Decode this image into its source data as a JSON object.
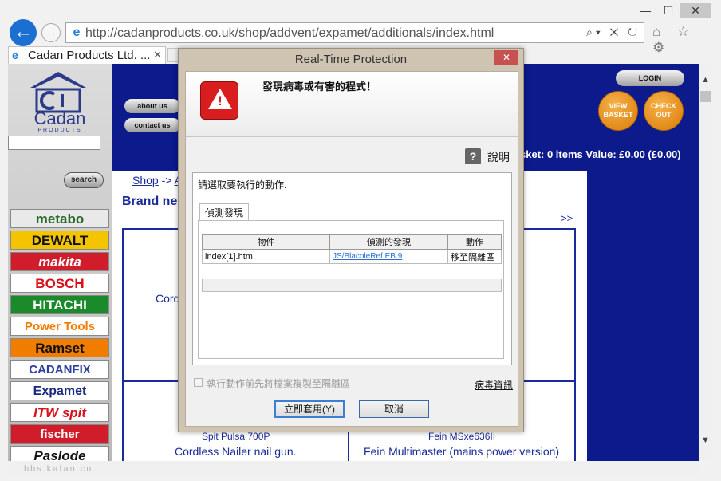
{
  "browser": {
    "url": "http://cadanproducts.co.uk/shop/addvent/expamet/additionals/index.html",
    "tab_title": "Cadan Products Ltd. ...",
    "window_minimize": "—",
    "window_maximize": "☐",
    "window_close": "✕",
    "back_glyph": "←",
    "forward_glyph": "→",
    "address_tools": "⌕▾ ✕ ↻",
    "toolbar_icons": "⌂ ☆ ⚙",
    "tab_close": "✕"
  },
  "page": {
    "logo_text": "Cadan",
    "logo_sub": "PRODUCTS",
    "search_label": "search",
    "nav": [
      {
        "label": "about us"
      },
      {
        "label": "contact us"
      }
    ],
    "login_label": "LOGIN",
    "view_basket_label": "VIEW BASKET",
    "checkout_label": "CHECK OUT",
    "basket_text": "sket: 0 items Value: £0.00 (£0.00)",
    "breadcrumb_shop": "Shop",
    "breadcrumb_sep": "->",
    "breadcrumb_next": "A",
    "brand_heading": "Brand ne",
    "next_link": ">>",
    "cord_text": "Cord",
    "brands": [
      {
        "name": "metabo",
        "bg": "#e9e9e9",
        "color": "#2a6b2a"
      },
      {
        "name": "DEWALT",
        "bg": "#f5c400",
        "color": "#111111"
      },
      {
        "name": "makita",
        "bg": "#d01c2b",
        "color": "#ffffff"
      },
      {
        "name": "BOSCH",
        "bg": "#ffffff",
        "color": "#d8101a"
      },
      {
        "name": "HITACHI",
        "bg": "#1a8a2a",
        "color": "#ffffff"
      },
      {
        "name": "Power Tools",
        "bg": "#ffffff",
        "color": "#f07c00"
      },
      {
        "name": "Ramset",
        "bg": "#f07c00",
        "color": "#111111"
      },
      {
        "name": "CADANFIX",
        "bg": "#ffffff",
        "color": "#2a3ea0"
      },
      {
        "name": "Expamet",
        "bg": "#ffffff",
        "color": "#1a2a80"
      },
      {
        "name": "ITW spit",
        "bg": "#ffffff",
        "color": "#d8101a"
      },
      {
        "name": "fischer",
        "bg": "#d01c2b",
        "color": "#ffffff"
      },
      {
        "name": "Paslode",
        "bg": "#ffffff",
        "color": "#111111"
      }
    ],
    "products": [
      {
        "model": "Spit Pulsa 700P",
        "desc": "Cordless Nailer nail gun."
      },
      {
        "model": "Fein MSxe636II",
        "desc": "Fein Multimaster (mains power version)"
      }
    ],
    "watermark": "bbs.kafan.cn"
  },
  "dialog": {
    "title": "Real-Time Protection",
    "close_glyph": "✕",
    "alert_title": "發現病毒或有害的程式！",
    "help_label": "說明",
    "help_glyph": "?",
    "choose_action": "請選取要執行的動作.",
    "tab_label": "偵測發現",
    "table": {
      "headers": [
        "物件",
        "偵測的發現",
        "動作"
      ],
      "rows": [
        {
          "object": "index[1].htm",
          "detection": "JS/BlacoleRef.EB.9",
          "action": "移至隔離區"
        }
      ]
    },
    "copy_checkbox_label": "執行動作前先將檔案複製至隔離區",
    "virus_info_link": "病毒資訊",
    "apply_button": "立即套用(Y)",
    "cancel_button": "取消"
  }
}
